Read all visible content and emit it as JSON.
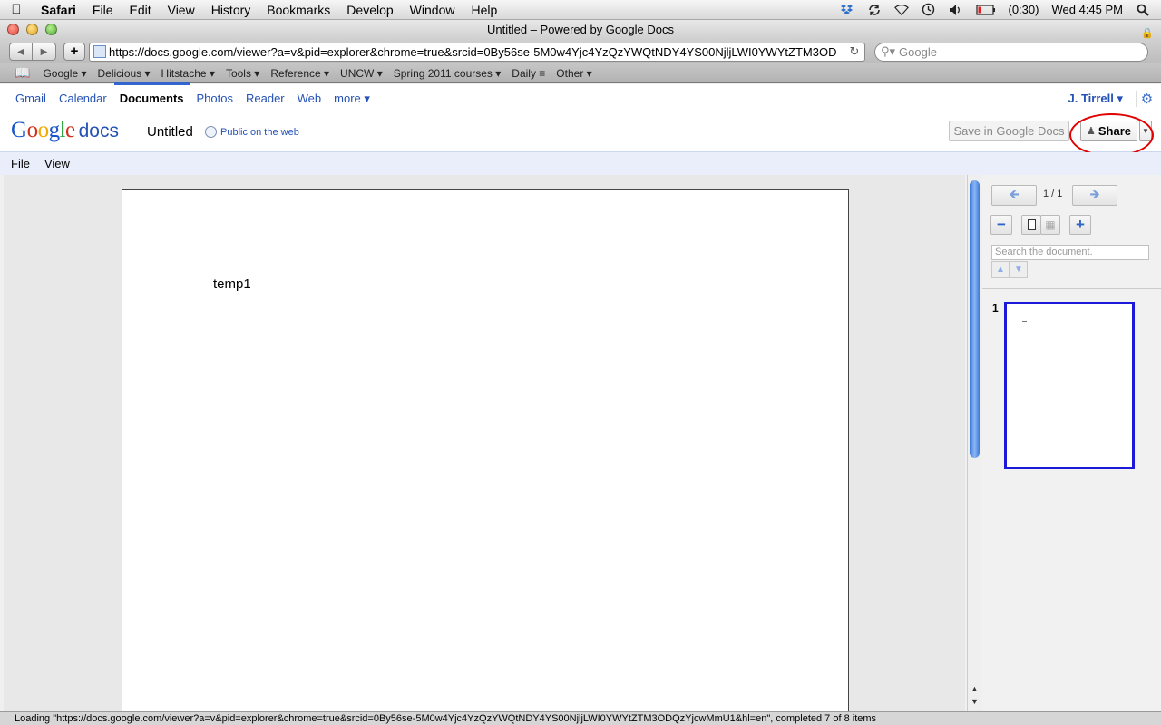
{
  "mac_menu": {
    "app": "Safari",
    "items": [
      "File",
      "Edit",
      "View",
      "History",
      "Bookmarks",
      "Develop",
      "Window",
      "Help"
    ],
    "battery": "(0:30)",
    "clock": "Wed 4:45 PM"
  },
  "window": {
    "title": "Untitled – Powered by Google Docs"
  },
  "toolbar": {
    "url": "https://docs.google.com/viewer?a=v&pid=explorer&chrome=true&srcid=0By56se-5M0w4Yjc4YzQzYWQtNDY4YS00NjljLWI0YWYtZTM3OD",
    "search_placeholder": "Google"
  },
  "bookmarks": [
    "Google",
    "Delicious",
    "Hitstache",
    "Tools",
    "Reference",
    "UNCW",
    "Spring 2011 courses",
    "Daily",
    "Other"
  ],
  "google_bar": {
    "links": [
      "Gmail",
      "Calendar",
      "Documents",
      "Photos",
      "Reader",
      "Web",
      "more"
    ],
    "active": "Documents",
    "user": "J. Tirrell"
  },
  "doc_header": {
    "logo_google": [
      "G",
      "o",
      "o",
      "g",
      "l",
      "e"
    ],
    "logo_docs": "docs",
    "title": "Untitled",
    "visibility": "Public on the web",
    "save_label": "Save in Google Docs",
    "share_label": "Share"
  },
  "doc_menu": [
    "File",
    "View"
  ],
  "document": {
    "body_text": "temp1"
  },
  "side_panel": {
    "page_indicator": "1 / 1",
    "search_placeholder": "Search the document.",
    "thumb_number": "1"
  },
  "status": "Loading \"https://docs.google.com/viewer?a=v&pid=explorer&chrome=true&srcid=0By56se-5M0w4Yjc4YzQzYWQtNDY4YS00NjljLWI0YWYtZTM3ODQzYjcwMmU1&hl=en\", completed 7 of 8 items",
  "colors": {
    "accent": "#2552b5",
    "highlight_circle": "#e00000",
    "thumb_border": "#1a1ad8"
  }
}
